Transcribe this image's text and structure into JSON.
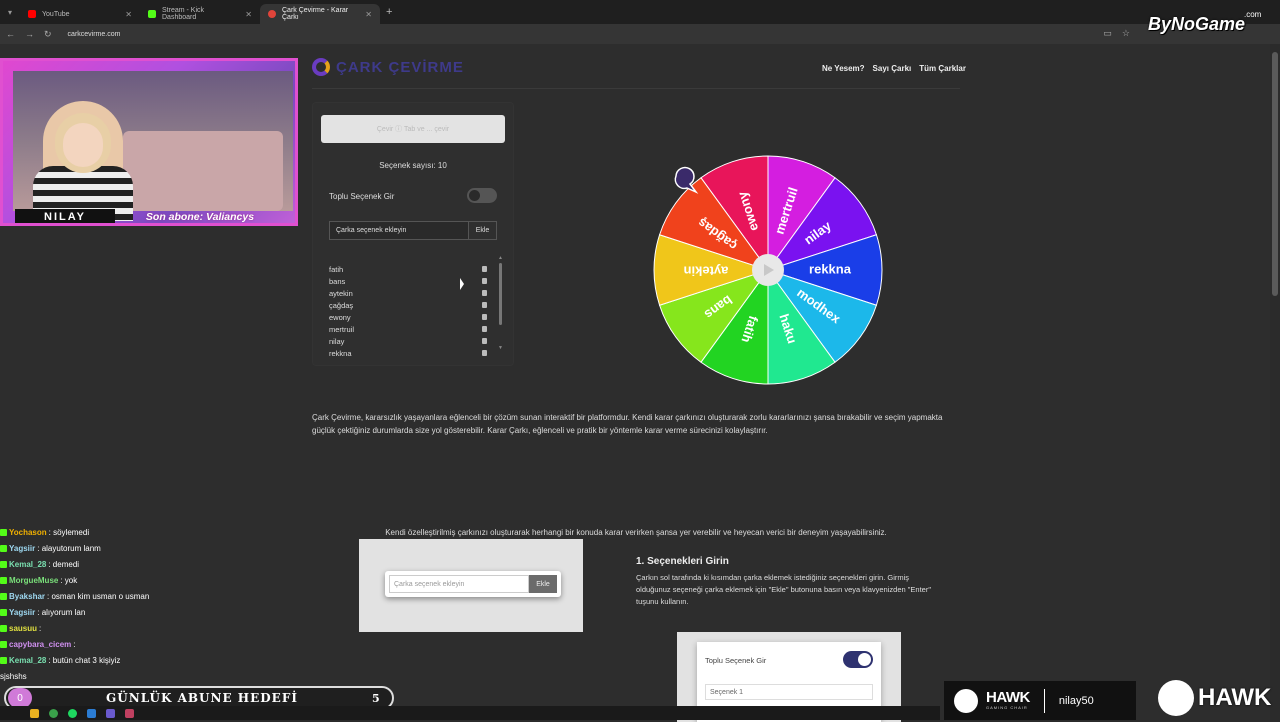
{
  "browser": {
    "tabs": [
      {
        "title": "YouTube",
        "color": "#ff0000",
        "active": false
      },
      {
        "title": "Stream - Kick Dashboard",
        "color": "#53fc18",
        "active": false
      },
      {
        "title": "Çark Çevirme - Karar Çarkı",
        "color": "#e0443a",
        "active": true
      }
    ],
    "url": "carkcevirme.com"
  },
  "site": {
    "logo_text": "ÇARK ÇEVİRME",
    "nav": [
      "Ne Yesem?",
      "Sayı Çarkı",
      "Tüm Çarklar"
    ]
  },
  "panel": {
    "spin_button": "Çevir ⓘ Tab ve ... çevir",
    "count_label": "Seçenek sayısı: 10",
    "bulk_label": "Toplu Seçenek Gir",
    "add_placeholder": "Çarka seçenek ekleyin",
    "add_button": "Ekle",
    "options": [
      "fatih",
      "bans",
      "aytekin",
      "çağdaş",
      "ewony",
      "mertruil",
      "nilay",
      "rekkna"
    ]
  },
  "wheel": {
    "segments": [
      {
        "label": "ewony",
        "color": "#e8155a"
      },
      {
        "label": "mertruil",
        "color": "#d41ee0"
      },
      {
        "label": "nilay",
        "color": "#7a12f0"
      },
      {
        "label": "rekkna",
        "color": "#1a3ee8"
      },
      {
        "label": "modhex",
        "color": "#1cb8ea"
      },
      {
        "label": "haku",
        "color": "#20e890"
      },
      {
        "label": "fatih",
        "color": "#22d422"
      },
      {
        "label": "bans",
        "color": "#86e61c"
      },
      {
        "label": "aytekin",
        "color": "#f0c61a"
      },
      {
        "label": "çağdaş",
        "color": "#f0421c"
      }
    ]
  },
  "content": {
    "description": "Çark Çevirme, kararsızlık yaşayanlara eğlenceli bir çözüm sunan interaktif bir platformdur. Kendi karar çarkınızı oluşturarak zorlu kararlarınızı şansa bırakabilir ve seçim yapmakta güçlük çektiğiniz durumlarda size yol gösterebilir. Karar Çarkı, eğlenceli ve pratik bir yöntemle karar verme sürecinizi kolaylaştırır.",
    "subtitle": "Kendi özelleştirilmiş çarkınızı oluşturarak herhangi bir konuda karar verirken şansa yer verebilir ve heyecan verici bir deneyim yaşayabilirsiniz.",
    "demo_placeholder": "Çarka seçenek ekleyin",
    "demo_button": "Ekle",
    "step_title": "1. Seçenekleri Girin",
    "step_text": "Çarkın sol tarafında ki kısımdan çarka eklemek istediğiniz seçenekleri girin. Girmiş olduğunuz seçeneği çarka eklemek için \"Ekle\" butonuna basın veya klavyenizden \"Enter\" tuşunu kullanın.",
    "demo2_label": "Toplu Seçenek Gir",
    "demo2_field": "Seçenek 1"
  },
  "stream": {
    "cam_name": "NILAY",
    "cam_sub": "Son abone: Valiancys",
    "chat": [
      {
        "user": "Yochason",
        "msg": " : söylemedi",
        "color": "#f0b000"
      },
      {
        "user": "Yagsiir",
        "msg": " : alayutorum lanm",
        "color": "#9ed8f0"
      },
      {
        "user": "Kemal_28",
        "msg": " : demedi",
        "color": "#7ae0b0"
      },
      {
        "user": "MorgueMuse",
        "msg": " : yok",
        "color": "#7ae07a"
      },
      {
        "user": "Byakshar",
        "msg": " : osman kim usman o usman",
        "color": "#9ed8f0"
      },
      {
        "user": "Yagsiir",
        "msg": " : alıyorum lan",
        "color": "#9ed8f0"
      },
      {
        "user": "sausuu",
        "msg": " : ",
        "color": "#e0e040"
      },
      {
        "user": "capybara_cicem",
        "msg": " : ",
        "color": "#d090f0"
      },
      {
        "user": "Kemal_28",
        "msg": " : butün chat 3 kişiyiz",
        "color": "#7ae0b0"
      },
      {
        "user": "",
        "msg": "sjshshs",
        "color": "#ffffff"
      }
    ],
    "goal_count_badge": "0",
    "goal_title": "GÜNLÜK ABUNE HEDEFİ",
    "goal_target": "5",
    "watermark": "ByNoGame",
    "watermark_sup": ".com",
    "sponsor_brand": "HAWK",
    "sponsor_brand_sub": "GAMING CHAIR",
    "sponsor_code": "nilay50",
    "brand2": "HAWK"
  }
}
